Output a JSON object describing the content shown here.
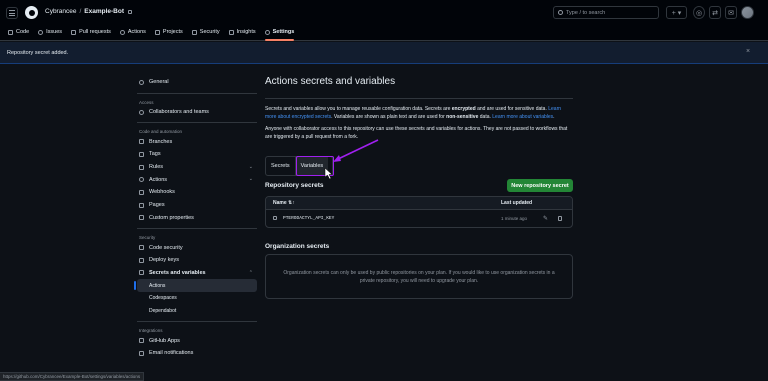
{
  "header": {
    "owner": "Cybrancee",
    "separator": "/",
    "repo": "Example-Bot",
    "search_placeholder": "Type / to search",
    "plus_label": "+ ▾"
  },
  "tabs": [
    "Code",
    "Issues",
    "Pull requests",
    "Actions",
    "Projects",
    "Security",
    "Insights",
    "Settings"
  ],
  "banner": {
    "message": "Repository secret added.",
    "close": "×"
  },
  "sidebar": {
    "general": "General",
    "access_heading": "Access",
    "collaborators": "Collaborators and teams",
    "code_heading": "Code and automation",
    "branches": "Branches",
    "tags": "Tags",
    "rules": "Rules",
    "actions": "Actions",
    "webhooks": "Webhooks",
    "pages": "Pages",
    "custom_properties": "Custom properties",
    "security_heading": "Security",
    "code_security": "Code security",
    "deploy_keys": "Deploy keys",
    "secrets_vars": "Secrets and variables",
    "sub_actions": "Actions",
    "sub_codespaces": "Codespaces",
    "sub_dependabot": "Dependabot",
    "integrations_heading": "Integrations",
    "github_apps": "GitHub Apps",
    "email_notifications": "Email notifications"
  },
  "main": {
    "title": "Actions secrets and variables",
    "p1_a": "Secrets and variables allow you to manage reusable configuration data. Secrets are ",
    "p1_b": "encrypted",
    "p1_c": " and are used for sensitive data. ",
    "p1_link1": "Learn more about encrypted secrets",
    "p1_d": ". Variables are shown as plain text and are used for ",
    "p1_e": "non-sensitive",
    "p1_f": " data. ",
    "p1_link2": "Learn more about variables",
    "p1_g": ".",
    "p2": "Anyone with collaborator access to this repository can use these secrets and variables for actions. They are not passed to workflows that are triggered by a pull request from a fork.",
    "seg_secrets": "Secrets",
    "seg_variables": "Variables",
    "repo_secrets_title": "Repository secrets",
    "new_secret_button": "New repository secret",
    "col_name": "Name ⇅↑",
    "col_updated": "Last updated",
    "secret_name": "PTERODACTYL_API_KEY",
    "secret_updated": "1 minute ago",
    "org_secrets_title": "Organization secrets",
    "org_message": "Organization secrets can only be used by public repositories on your plan. If you would like to use organization secrets in a private repository, you will need to upgrade your plan."
  },
  "status_url": "https://github.com/Cybrancee/Example-Bot/settings/variables/actions",
  "colors": {
    "accent": "#1f6feb",
    "highlight": "#a020f0",
    "button": "#238636",
    "link": "#4493f8"
  }
}
